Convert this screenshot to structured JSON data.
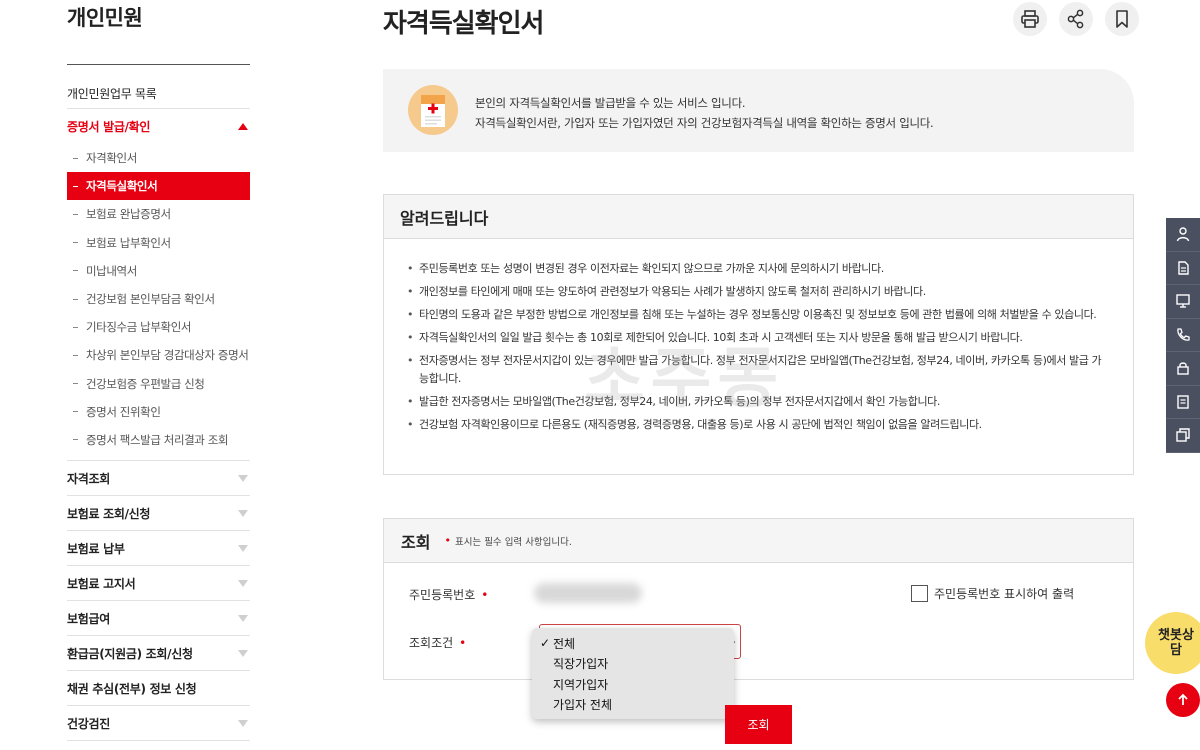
{
  "sidebar": {
    "title": "개인민원",
    "items": [
      {
        "label": "개인민원업무 목록"
      },
      {
        "label": "증명서 발급/확인",
        "expanded": true,
        "sub": [
          "자격확인서",
          "자격득실확인서",
          "보험료 완납증명서",
          "보험료 납부확인서",
          "미납내역서",
          "건강보험 본인부담금 확인서",
          "기타징수금 납부확인서",
          "차상위 본인부담 경감대상자 증명서",
          "건강보험증 우편발급 신청",
          "증명서 진위확인",
          "증명서 팩스발급 처리결과 조회"
        ],
        "active_sub": "자격득실확인서"
      },
      {
        "label": "자격조회"
      },
      {
        "label": "보험료 조회/신청"
      },
      {
        "label": "보험료 납부"
      },
      {
        "label": "보험료 고지서"
      },
      {
        "label": "보험급여"
      },
      {
        "label": "환급금(지원금) 조회/신청"
      },
      {
        "label": "채권 추심(전부) 정보 신청"
      },
      {
        "label": "건강검진"
      }
    ]
  },
  "header": {
    "title": "자격득실확인서",
    "icons": [
      "print-icon",
      "share-icon",
      "bookmark-icon"
    ]
  },
  "intro": {
    "line1": "본인의 자격득실확인서를 발급받을 수 있는 서비스 입니다.",
    "line2": "자격득실확인서란, 가입자 또는 가입자였던 자의 건강보험자격득실 내역을 확인하는 증명서 입니다."
  },
  "notice": {
    "title": "알려드립니다",
    "items": [
      "주민등록번호 또는 성명이 변경된 경우 이전자료는 확인되지 않으므로 가까운 지사에 문의하시기 바랍니다.",
      "개인정보를 타인에게 매매 또는 양도하여 관련정보가 악용되는 사례가 발생하지 않도록 철저히 관리하시기 바랍니다.",
      "타인명의 도용과 같은 부정한 방법으로 개인정보를 침해 또는 누설하는 경우 정보통신망 이용촉진 및 정보보호 등에 관한 법률에 의해 처벌받을 수 있습니다.",
      "자격득실확인서의 일일 발급 횟수는 총 10회로 제한되어 있습니다. 10회 초과 시 고객센터 또는 지사 방문을 통해 발급 받으시기 바랍니다.",
      "전자증명서는 정부 전자문서지갑이 있는 경우에만 발급 가능합니다. 정부 전자문서지갑은 모바일앱(The건강보험, 정부24, 네이버, 카카오톡 등)에서 발급 가능합니다.",
      "발급한 전자증명서는 모바일앱(The건강보험, 정부24, 네이버, 카카오톡 등)의 정부 전자문서지갑에서 확인 가능합니다.",
      "건강보험 자격확인용이므로 다른용도 (재직증명용, 경력증명용, 대출용 등)로 사용 시 공단에 법적인 책임이 없음을 알려드립니다."
    ],
    "watermark": "초주몽"
  },
  "query": {
    "title": "조회",
    "required_note": "표시는 필수 입력 사항입니다.",
    "rrn_label": "주민등록번호",
    "show_rrn_label": "주민등록번호 표시하여 출력",
    "condition_label": "조회조건",
    "options": [
      "전체",
      "직장가입자",
      "지역가입자",
      "가입자 전체"
    ],
    "selected_option": "전체",
    "submit_label": "조회"
  },
  "rail": {
    "icons": [
      "user-icon",
      "document-icon",
      "monitor-icon",
      "phone-icon",
      "lock-icon",
      "list-icon",
      "copy-icon"
    ]
  },
  "chatbot": {
    "label": "챗봇상담"
  },
  "colors": {
    "accent": "#e60012",
    "rail": "#4a5060",
    "chatbot": "#f9dd6b"
  }
}
